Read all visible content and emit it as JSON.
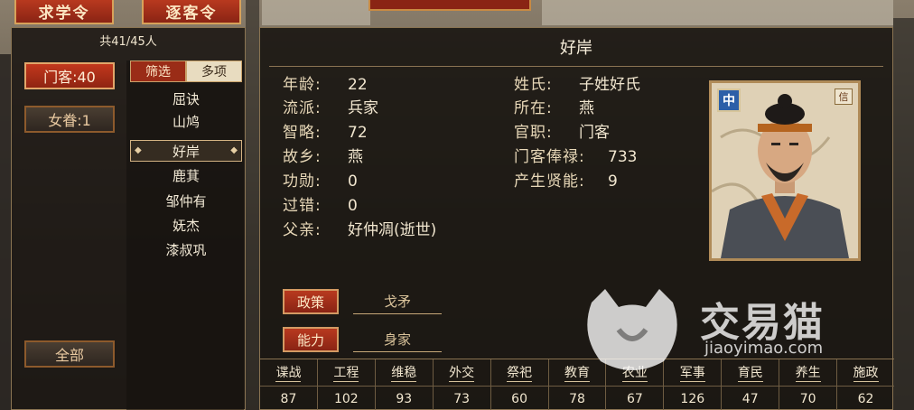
{
  "top_buttons": {
    "recruit": "求学令",
    "expel": "逐客令"
  },
  "left": {
    "count": "共41/45人",
    "sidebar": {
      "retainers": "门客:40",
      "family": "女眷:1",
      "all": "全部"
    },
    "filter": {
      "tab_filter": "筛选",
      "tab_multi": "多项"
    },
    "names": [
      "屈诀",
      "山鸠",
      "好岸",
      "鹿萁",
      "邹仲有",
      "妩杰",
      "漆叔巩"
    ],
    "selected_index": 2
  },
  "detail": {
    "title": "好岸",
    "attrs_left": [
      {
        "label": "年龄:",
        "value": "22"
      },
      {
        "label": "流派:",
        "value": "兵家"
      },
      {
        "label": "智略:",
        "value": "72"
      },
      {
        "label": "故乡:",
        "value": "燕"
      },
      {
        "label": "功勋:",
        "value": "0"
      },
      {
        "label": "过错:",
        "value": "0"
      },
      {
        "label": "父亲:",
        "value": "好仲凋(逝世)"
      }
    ],
    "attrs_right": [
      {
        "label": "姓氏:",
        "value": "子姓好氏"
      },
      {
        "label": "所在:",
        "value": "燕"
      },
      {
        "label": "官职:",
        "value": "门客"
      },
      {
        "label": "门客俸禄:",
        "value": "733"
      },
      {
        "label": "产生贤能:",
        "value": "9"
      }
    ],
    "portrait": {
      "badge": "中",
      "seal": "信"
    },
    "policy": {
      "label": "政策",
      "value": "戈矛"
    },
    "ability": {
      "label": "能力",
      "value": "身家"
    },
    "stats": [
      {
        "name": "谍战",
        "value": "87"
      },
      {
        "name": "工程",
        "value": "102"
      },
      {
        "name": "维稳",
        "value": "93"
      },
      {
        "name": "外交",
        "value": "73"
      },
      {
        "name": "祭祀",
        "value": "60"
      },
      {
        "name": "教育",
        "value": "78"
      },
      {
        "name": "农业",
        "value": "67"
      },
      {
        "name": "军事",
        "value": "126"
      },
      {
        "name": "育民",
        "value": "47"
      },
      {
        "name": "养生",
        "value": "70"
      },
      {
        "name": "施政",
        "value": "62"
      }
    ]
  },
  "watermark": {
    "cn": "交易猫",
    "en": "jiaoyimao.com"
  },
  "colors": {
    "accent_red": "#9a2c17",
    "border_gold": "#8a7452"
  }
}
